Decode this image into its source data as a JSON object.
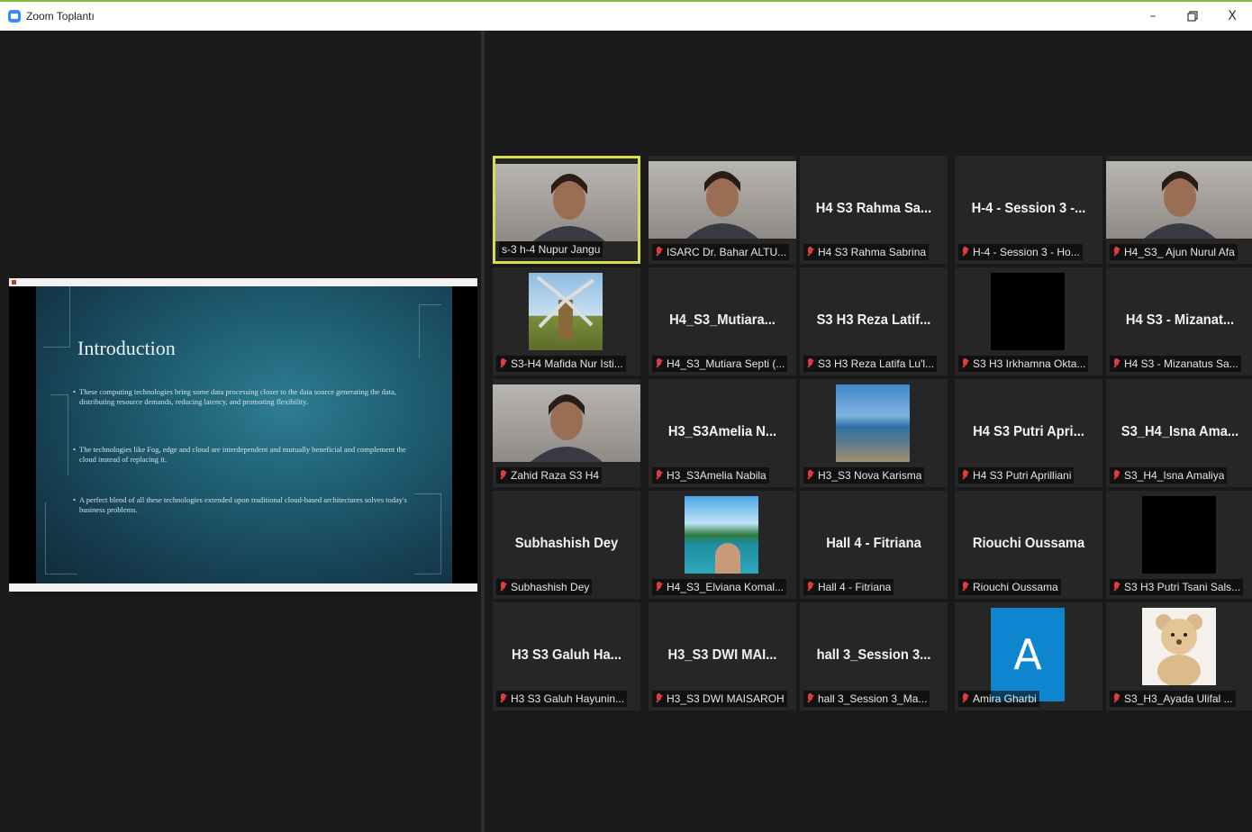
{
  "window": {
    "title": "Zoom Toplantı",
    "controls": {
      "minimize": "–",
      "maximize": "ð",
      "close": "X"
    }
  },
  "colors": {
    "active_speaker_border": "#d7e04a",
    "muted_mic": "#e23b3b",
    "avatar_bg": "#0e86cf"
  },
  "shared_screen": {
    "slide_title": "Introduction",
    "bullets": [
      "These computing technologies bring some data processing closer to the data source generating the data, distributing resource demands, reducing latency, and promoting flexibility.",
      "The technologies like Fog, edge and cloud are interdependent and mutually beneficial and complement the cloud instead of replacing it.",
      "A perfect blend of all these technologies extended upon traditional cloud-based architectures solves today's business problems."
    ]
  },
  "participants": [
    {
      "label": "s-3 h-4 Nupur Jangu",
      "big": "",
      "video": "video-person",
      "active": true,
      "muted": false
    },
    {
      "label": "ISARC Dr. Bahar ALTU...",
      "big": "",
      "video": "video-person",
      "muted": true
    },
    {
      "label": "H4 S3 Rahma Sabrina",
      "big": "H4 S3 Rahma Sa...",
      "muted": true
    },
    {
      "label": "H-4 - Session 3 - Ho...",
      "big": "H-4 - Session 3 -...",
      "muted": true
    },
    {
      "label": "H4_S3_ Ajun Nurul Afa",
      "big": "",
      "video": "video-person",
      "muted": true
    },
    {
      "label": "S3-H4 Mafida Nur Isti...",
      "big": "",
      "video": "video-windmill",
      "muted": true
    },
    {
      "label": "H4_S3_Mutiara Septi (...",
      "big": "H4_S3_Mutiara...",
      "muted": true
    },
    {
      "label": "S3 H3 Reza Latifa Lu'l...",
      "big": "S3 H3 Reza Latif...",
      "muted": true
    },
    {
      "label": "S3 H3 Irkhamna Okta...",
      "big": "",
      "video": "video-black",
      "muted": true
    },
    {
      "label": "H4 S3 - Mizanatus Sa...",
      "big": "H4 S3 - Mizanat...",
      "muted": true
    },
    {
      "label": "Zahid Raza S3 H4",
      "big": "",
      "video": "video-person",
      "muted": true
    },
    {
      "label": "H3_S3Amelia Nabila",
      "big": "H3_S3Amelia N...",
      "muted": true
    },
    {
      "label": "H3_S3 Nova Karisma",
      "big": "",
      "video": "video-beach",
      "muted": true
    },
    {
      "label": "H4 S3 Putri Aprilliani",
      "big": "H4 S3 Putri Apri...",
      "muted": true
    },
    {
      "label": "S3_H4_Isna Amaliya",
      "big": "S3_H4_Isna Ama...",
      "muted": true
    },
    {
      "label": "Subhashish Dey",
      "big": "Subhashish Dey",
      "muted": true
    },
    {
      "label": "H4_S3_Elviana Komal...",
      "big": "",
      "video": "video-lake",
      "muted": true
    },
    {
      "label": "Hall 4 - Fitriana",
      "big": "Hall 4 - Fitriana",
      "muted": true
    },
    {
      "label": "Riouchi Oussama",
      "big": "Riouchi Oussama",
      "muted": true
    },
    {
      "label": "S3 H3 Putri Tsani Sals...",
      "big": "",
      "video": "video-black",
      "muted": true
    },
    {
      "label": "H3 S3 Galuh Hayunin...",
      "big": "H3 S3 Galuh Ha...",
      "muted": true
    },
    {
      "label": "H3_S3 DWI MAISAROH",
      "big": "H3_S3 DWI MAI...",
      "muted": true
    },
    {
      "label": "hall 3_Session  3_Ma...",
      "big": "hall 3_Session  3...",
      "muted": true
    },
    {
      "label": "Amira Gharbi",
      "big": "",
      "avatar": "A",
      "muted": true
    },
    {
      "label": "S3_H3_Ayada Ulifal ...",
      "big": "",
      "video": "video-teddy",
      "muted": true
    }
  ]
}
